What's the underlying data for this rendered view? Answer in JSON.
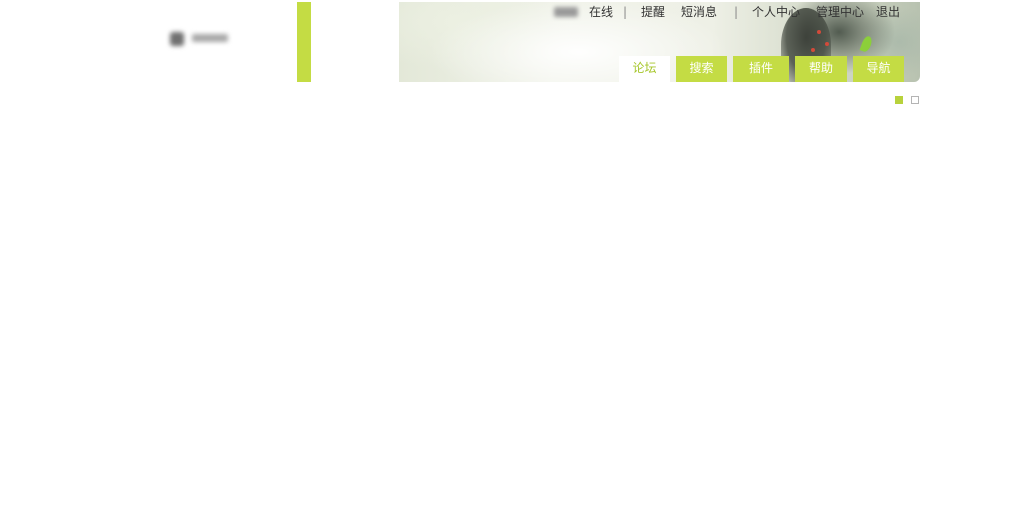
{
  "header": {
    "top_links": {
      "online": "在线",
      "separator": "|",
      "reminders": "提醒",
      "messages": "短消息",
      "profile": "个人中心",
      "admin": "管理中心",
      "logout": "退出"
    },
    "nav_tabs": [
      {
        "label": "论坛",
        "active": true
      },
      {
        "label": "搜索",
        "active": false
      },
      {
        "label": "插件",
        "active": false
      },
      {
        "label": "帮助",
        "active": false
      },
      {
        "label": "导航",
        "active": false
      }
    ]
  },
  "colors": {
    "accent": "#c4dc44",
    "active_tab_text": "#a6c62a",
    "link_text": "#333333"
  },
  "icons": [
    "logo-icon",
    "leaf-decoration"
  ]
}
